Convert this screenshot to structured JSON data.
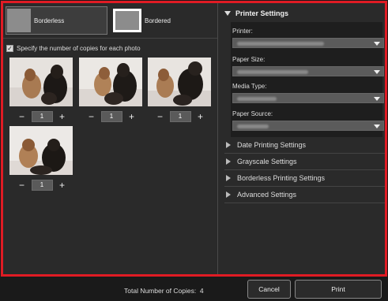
{
  "layouts": [
    {
      "label": "Borderless",
      "selected": true
    },
    {
      "label": "Bordered",
      "selected": false
    }
  ],
  "copies_checkbox": {
    "label": "Specify the number of copies for each photo",
    "checked": true,
    "check_glyph": "✓"
  },
  "photos": [
    {
      "copies": "1"
    },
    {
      "copies": "1"
    },
    {
      "copies": "1"
    },
    {
      "copies": "1"
    }
  ],
  "stepper": {
    "minus": "−",
    "plus": "+"
  },
  "printer_settings": {
    "title": "Printer Settings",
    "expanded": true,
    "fields": [
      {
        "label": "Printer:",
        "value": ""
      },
      {
        "label": "Paper Size:",
        "value": ""
      },
      {
        "label": "Media Type:",
        "value": ""
      },
      {
        "label": "Paper Source:",
        "value": ""
      }
    ]
  },
  "sections": [
    {
      "label": "Date Printing Settings"
    },
    {
      "label": "Grayscale Settings"
    },
    {
      "label": "Borderless Printing Settings"
    },
    {
      "label": "Advanced Settings"
    }
  ],
  "footer": {
    "total_label": "Total Number of Copies:",
    "total_value": "4",
    "cancel": "Cancel",
    "print": "Print"
  },
  "colors": {
    "highlight_border": "#e01b24",
    "panel_bg": "#2a2a2a"
  }
}
